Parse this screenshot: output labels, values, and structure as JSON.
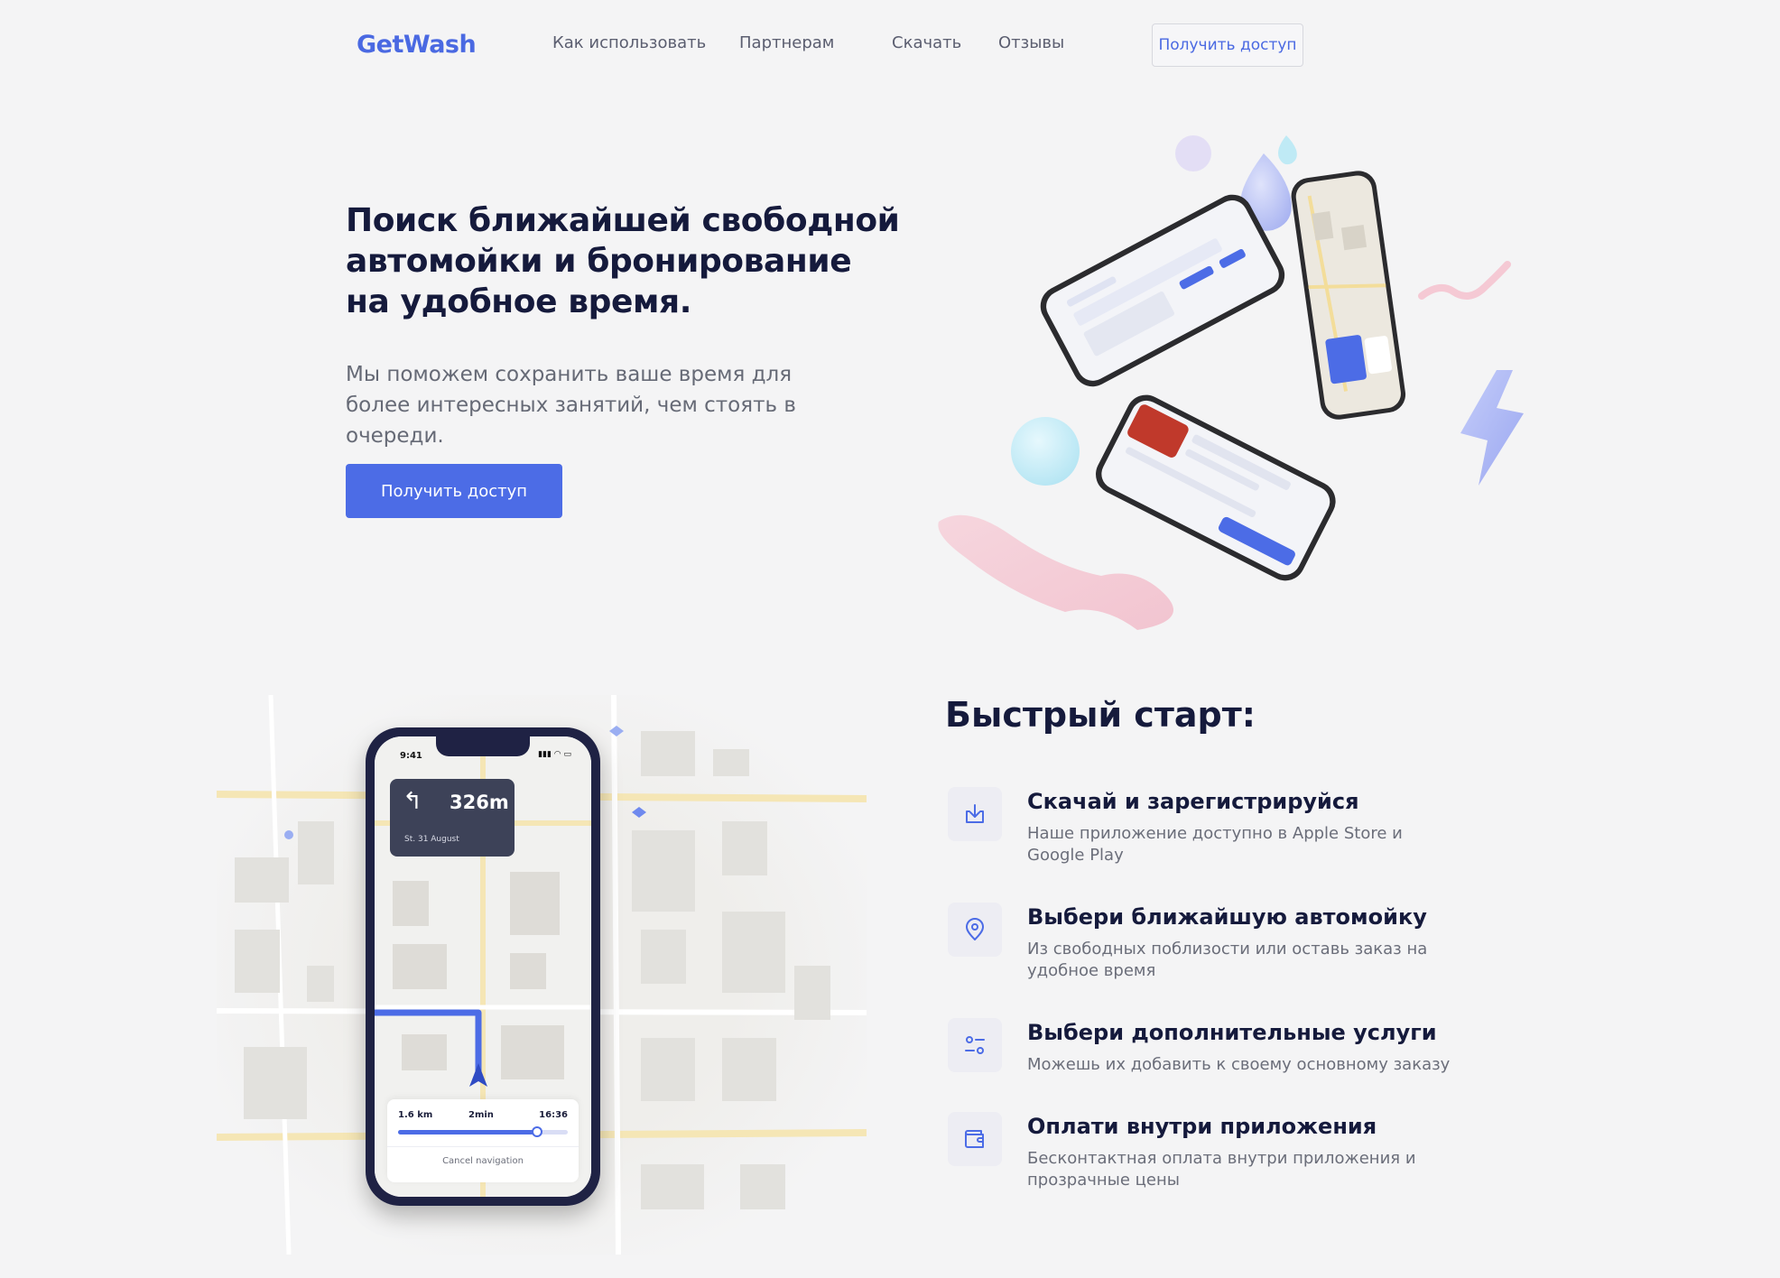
{
  "header": {
    "logo": "GetWash",
    "nav": [
      "Как использовать",
      "Партнерам",
      "Скачать",
      "Отзывы"
    ],
    "cta_label": "Получить доступ"
  },
  "hero": {
    "title": "Поиск ближайшей свободной автомойки и бронирование на удобное время.",
    "subtitle": "Мы поможем сохранить ваше время для более интересных занятий, чем стоять в очереди.",
    "cta_label": "Получить доступ"
  },
  "quick_start": {
    "title": "Быстрый старт:",
    "items": [
      {
        "icon": "download-icon",
        "title": "Скачай и зарегистрируйся",
        "desc": "Наше приложение доступно в Apple Store и Google Play"
      },
      {
        "icon": "location-pin-icon",
        "title": "Выбери ближайшую автомойку",
        "desc": "Из свободных поблизости или оставь заказ на удобное время"
      },
      {
        "icon": "settings-sliders-icon",
        "title": "Выбери дополнительные услуги",
        "desc": "Можешь их добавить к своему основному заказу"
      },
      {
        "icon": "wallet-icon",
        "title": "Оплати внутри приложения",
        "desc": "Бесконтактная оплата внутри приложения и прозрачные цены"
      }
    ]
  },
  "phone": {
    "status_time": "9:41",
    "distance": "326m",
    "street": "St. 31 August",
    "trip_km": "1.6 km",
    "trip_time": "2min",
    "arrival": "16:36",
    "progress": 0.82,
    "cancel_label": "Cancel navigation"
  },
  "colors": {
    "accent": "#4c6ce6",
    "title": "#151a3c",
    "background": "#f4f4f5"
  }
}
